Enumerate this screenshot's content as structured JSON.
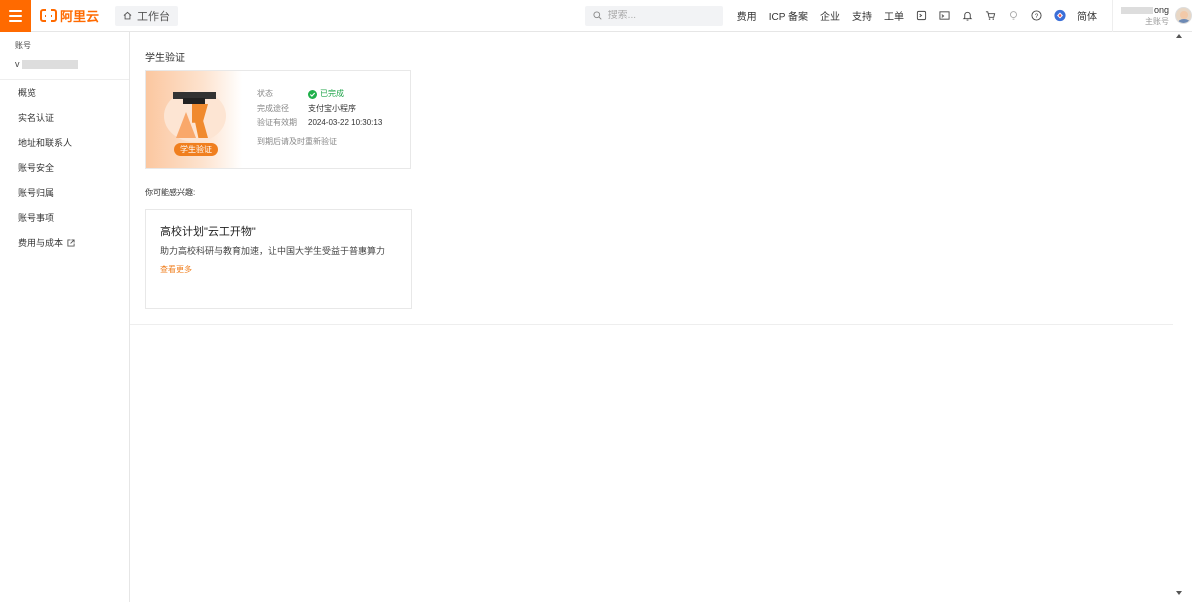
{
  "header": {
    "logo_text": "阿里云",
    "workbench_label": "工作台",
    "search_placeholder": "搜索...",
    "nav": [
      "费用",
      "ICP 备案",
      "企业",
      "支持",
      "工单"
    ],
    "lang": "简体",
    "user_name_suffix": "ong",
    "user_role": "主账号",
    "accent_color": "#ff6a00"
  },
  "sidebar": {
    "account_label": "账号",
    "account_value_prefix": "v",
    "items": [
      "概览",
      "实名认证",
      "地址和联系人",
      "账号安全",
      "账号归属",
      "账号事项",
      "费用与成本"
    ]
  },
  "main": {
    "page_title": "学生验证",
    "card": {
      "badge": "学生验证",
      "status_label": "状态",
      "status_value": "已完成",
      "method_label": "完成途径",
      "method_value": "支付宝小程序",
      "validity_label": "验证有效期",
      "validity_value": "2024-03-22 10:30:13",
      "note": "到期后请及时重新验证"
    },
    "interest_title": "你可能感兴趣:",
    "promo": {
      "title": "高校计划\"云工开物\"",
      "desc": "助力高校科研与教育加速，让中国大学生受益于普惠算力",
      "more": "查看更多"
    }
  }
}
